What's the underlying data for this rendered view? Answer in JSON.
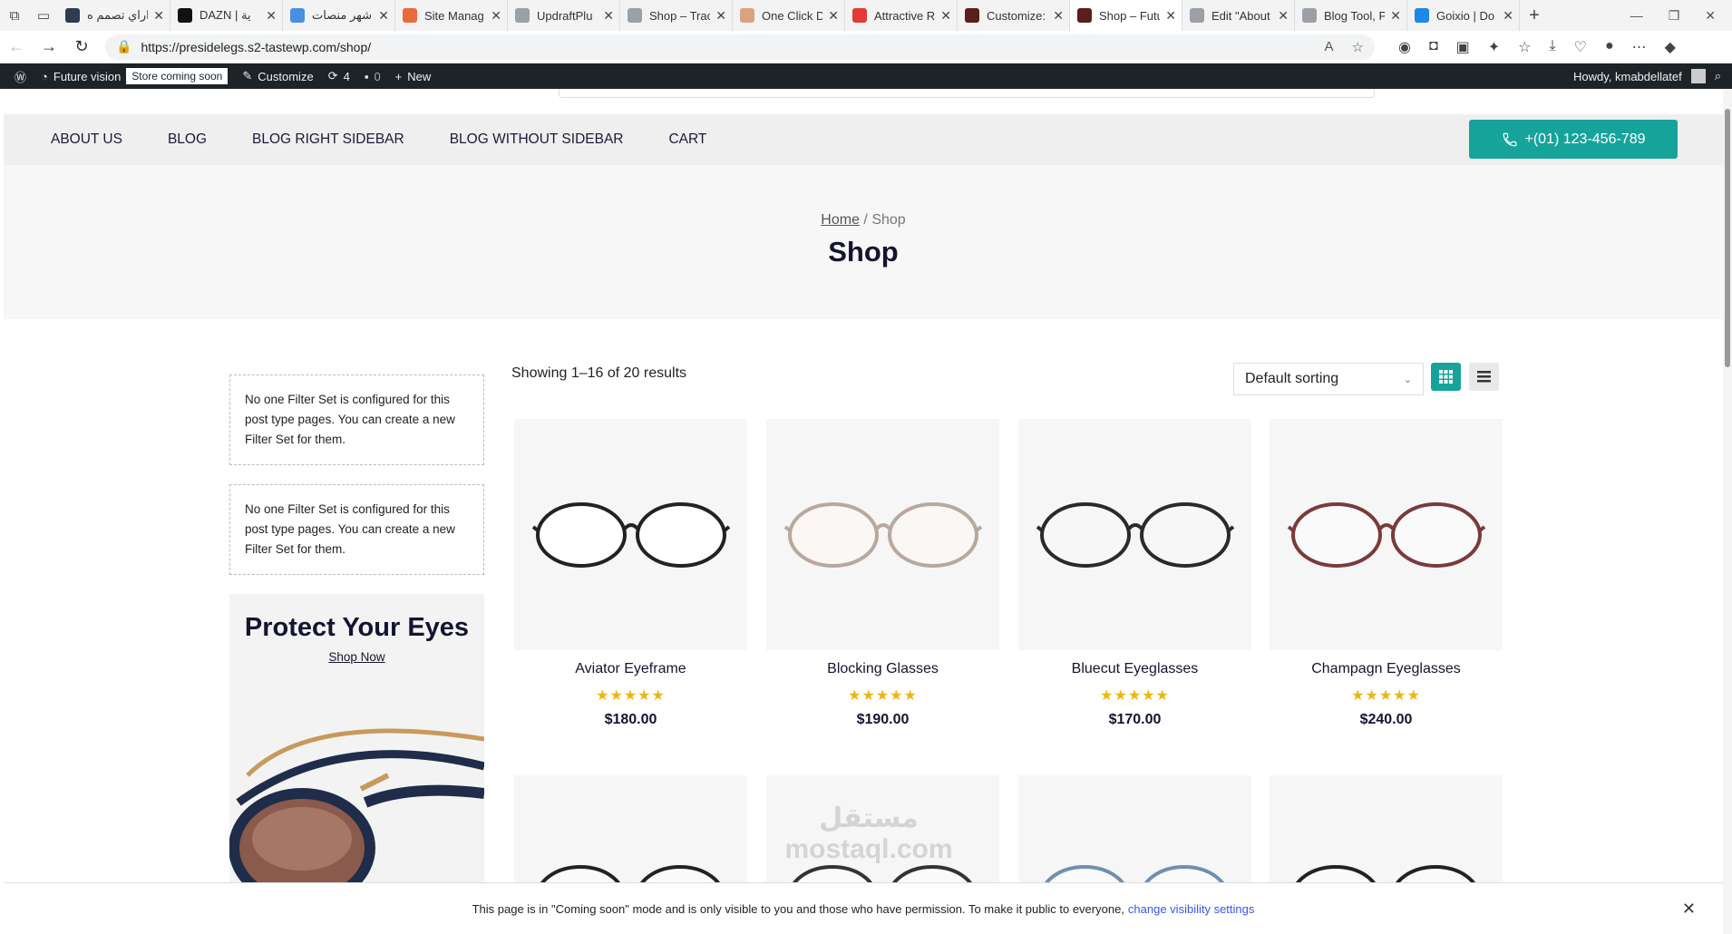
{
  "browser": {
    "tabs": [
      {
        "title": "اراي تصمم ه",
        "color": "#2c3e50"
      },
      {
        "title": "DAZN | ية",
        "color": "#111111"
      },
      {
        "title": "اشهر منصات",
        "color": "#4a90e2"
      },
      {
        "title": "Site Manag",
        "color": "#e96a3c"
      },
      {
        "title": "UpdraftPlu",
        "color": "#9aa0a6"
      },
      {
        "title": "Shop – Trac",
        "color": "#9aa0a6"
      },
      {
        "title": "One Click D",
        "color": "#d9a380"
      },
      {
        "title": "Attractive R",
        "color": "#e53935"
      },
      {
        "title": "Customize:",
        "color": "#5a1e1e"
      },
      {
        "title": "Shop – Futu",
        "color": "#5a1e1e"
      },
      {
        "title": "Edit \"About",
        "color": "#9aa0a6"
      },
      {
        "title": "Blog Tool, P",
        "color": "#9aa0a6"
      },
      {
        "title": "Goixio | Do",
        "color": "#1e88e5"
      }
    ],
    "url": "https://presidelegs.s2-tastewp.com/shop/"
  },
  "adminbar": {
    "site_name": "Future vision",
    "badge": "Store coming soon",
    "customize": "Customize",
    "updates": "4",
    "comments": "0",
    "new": "New",
    "howdy": "Howdy, kmabdellatef"
  },
  "nav": {
    "items": [
      "About Us",
      "Blog",
      "Blog Right Sidebar",
      "Blog Without Sidebar",
      "Cart"
    ],
    "phone": "+(01) 123-456-789"
  },
  "hero": {
    "breadcrumb_home": "Home",
    "breadcrumb_sep": " / ",
    "breadcrumb_current": "Shop",
    "title": "Shop"
  },
  "sidebar": {
    "filter_msg_1": "No one Filter Set is configured for this post type pages. You can create a new Filter Set for them.",
    "filter_msg_2": "No one Filter Set is configured for this post type pages. You can create a new Filter Set for them.",
    "promo_title": "Protect Your Eyes",
    "promo_link": "Shop Now"
  },
  "toolbar": {
    "results": "Showing 1–16 of 20 results",
    "sort": "Default sorting"
  },
  "products": [
    {
      "name": "Aviator Eyeframe",
      "price": "$180.00",
      "stars": "★★★★★",
      "frame_color": "#222222",
      "lens_color": "#ffffff"
    },
    {
      "name": "Blocking Glasses",
      "price": "$190.00",
      "stars": "★★★★★",
      "frame_color": "#b8a89e",
      "lens_color": "#fbf7f4"
    },
    {
      "name": "Bluecut Eyeglasses",
      "price": "$170.00",
      "stars": "★★★★★",
      "frame_color": "#2a2a2a",
      "lens_color": "#f7f7f7"
    },
    {
      "name": "Champagn Eyeglasses",
      "price": "$240.00",
      "stars": "★★★★★",
      "frame_color": "#7a3b3b",
      "lens_color": "#fafafa"
    }
  ],
  "row2_frames": [
    "#222222",
    "#333333",
    "#6f8fb0",
    "#222222"
  ],
  "watermark": "مستقل mostaql.com",
  "coming_soon": {
    "text": "This page is in \"Coming soon\" mode and is only visible to you and those who have permission. To make it public to everyone,",
    "link": "change visibility settings"
  },
  "colors": {
    "accent": "#16a39a",
    "stars": "#e9b714",
    "adminbar": "#1d2327"
  }
}
